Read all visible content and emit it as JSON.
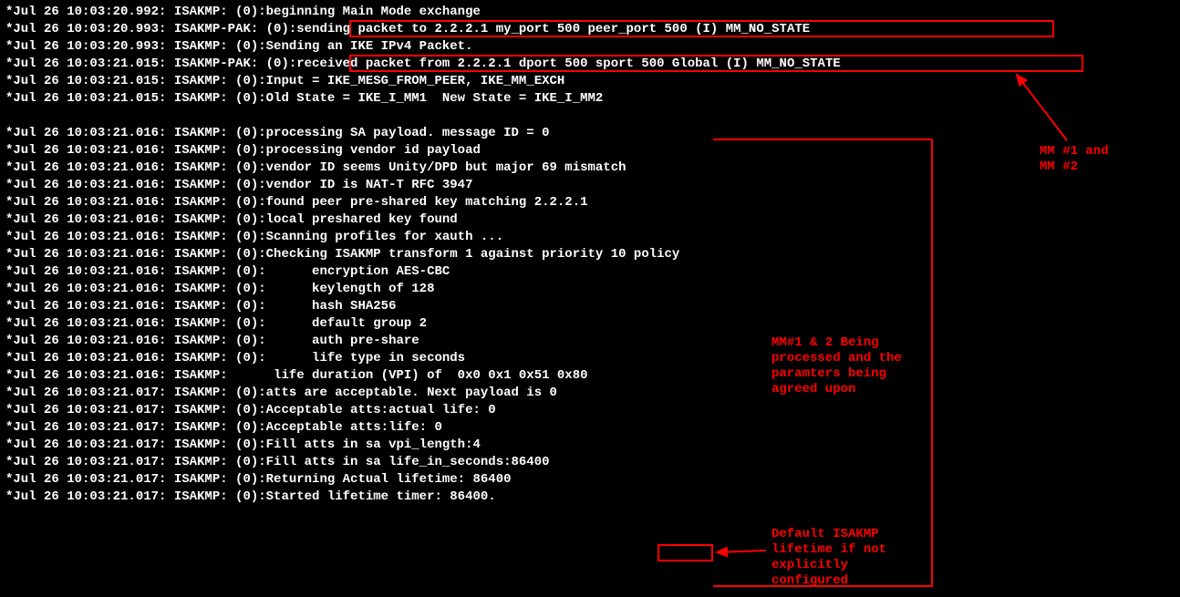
{
  "log_lines": [
    "*Jul 26 10:03:20.992: ISAKMP: (0):beginning Main Mode exchange",
    "*Jul 26 10:03:20.993: ISAKMP-PAK: (0):sending packet to 2.2.2.1 my_port 500 peer_port 500 (I) MM_NO_STATE",
    "*Jul 26 10:03:20.993: ISAKMP: (0):Sending an IKE IPv4 Packet.",
    "*Jul 26 10:03:21.015: ISAKMP-PAK: (0):received packet from 2.2.2.1 dport 500 sport 500 Global (I) MM_NO_STATE",
    "*Jul 26 10:03:21.015: ISAKMP: (0):Input = IKE_MESG_FROM_PEER, IKE_MM_EXCH",
    "*Jul 26 10:03:21.015: ISAKMP: (0):Old State = IKE_I_MM1  New State = IKE_I_MM2",
    "",
    "*Jul 26 10:03:21.016: ISAKMP: (0):processing SA payload. message ID = 0",
    "*Jul 26 10:03:21.016: ISAKMP: (0):processing vendor id payload",
    "*Jul 26 10:03:21.016: ISAKMP: (0):vendor ID seems Unity/DPD but major 69 mismatch",
    "*Jul 26 10:03:21.016: ISAKMP: (0):vendor ID is NAT-T RFC 3947",
    "*Jul 26 10:03:21.016: ISAKMP: (0):found peer pre-shared key matching 2.2.2.1",
    "*Jul 26 10:03:21.016: ISAKMP: (0):local preshared key found",
    "*Jul 26 10:03:21.016: ISAKMP: (0):Scanning profiles for xauth ...",
    "*Jul 26 10:03:21.016: ISAKMP: (0):Checking ISAKMP transform 1 against priority 10 policy",
    "*Jul 26 10:03:21.016: ISAKMP: (0):      encryption AES-CBC",
    "*Jul 26 10:03:21.016: ISAKMP: (0):      keylength of 128",
    "*Jul 26 10:03:21.016: ISAKMP: (0):      hash SHA256",
    "*Jul 26 10:03:21.016: ISAKMP: (0):      default group 2",
    "*Jul 26 10:03:21.016: ISAKMP: (0):      auth pre-share",
    "*Jul 26 10:03:21.016: ISAKMP: (0):      life type in seconds",
    "*Jul 26 10:03:21.016: ISAKMP:      life duration (VPI) of  0x0 0x1 0x51 0x80",
    "*Jul 26 10:03:21.017: ISAKMP: (0):atts are acceptable. Next payload is 0",
    "*Jul 26 10:03:21.017: ISAKMP: (0):Acceptable atts:actual life: 0",
    "*Jul 26 10:03:21.017: ISAKMP: (0):Acceptable atts:life: 0",
    "*Jul 26 10:03:21.017: ISAKMP: (0):Fill atts in sa vpi_length:4",
    "*Jul 26 10:03:21.017: ISAKMP: (0):Fill atts in sa life_in_seconds:86400",
    "*Jul 26 10:03:21.017: ISAKMP: (0):Returning Actual lifetime: 86400",
    "*Jul 26 10:03:21.017: ISAKMP: (0):Started lifetime timer: 86400."
  ],
  "annotations": {
    "mm12": "MM #1 and\nMM #2",
    "processed": "MM#1 & 2 Being\nprocessed and the\nparamters being\nagreed upon",
    "lifetime": "Default ISAKMP\nlifetime if not\nexplicitly\nconfigured"
  }
}
